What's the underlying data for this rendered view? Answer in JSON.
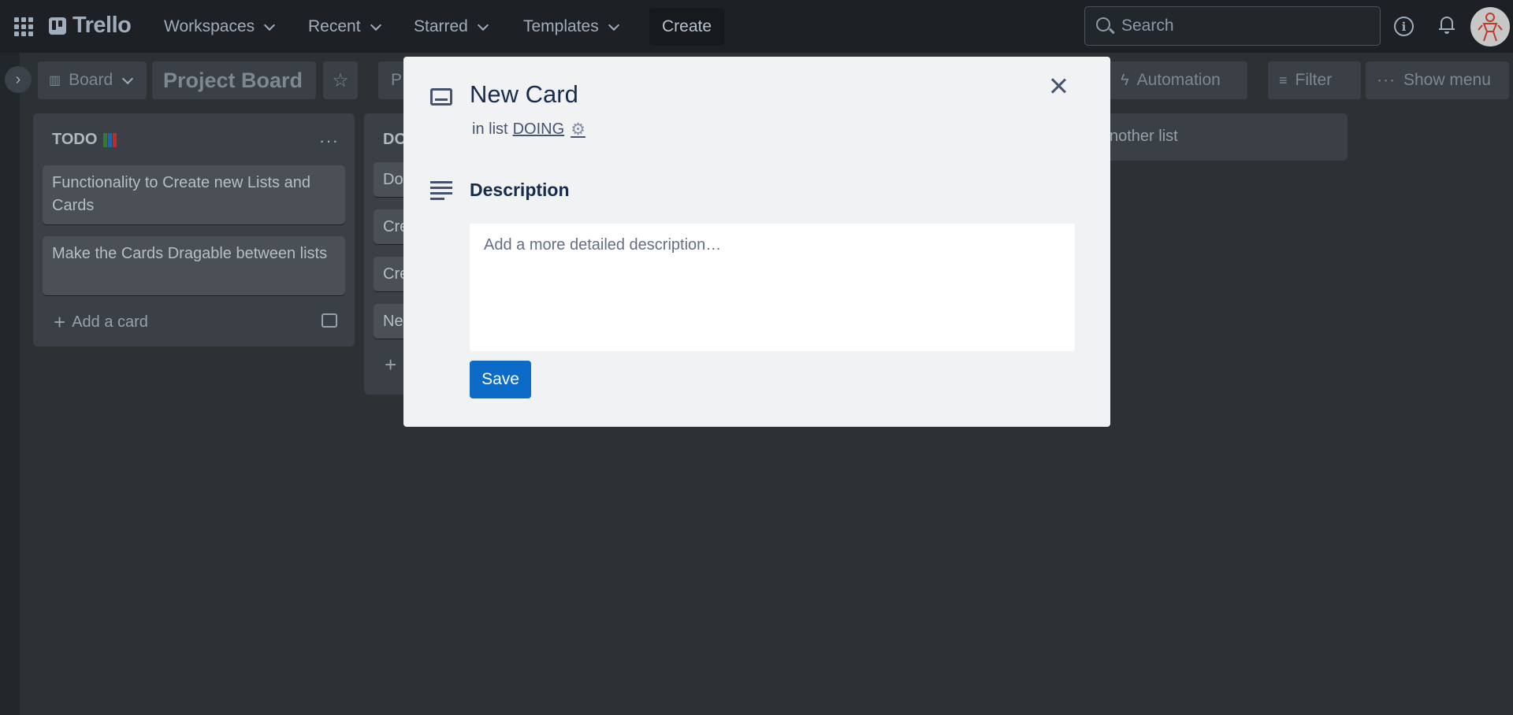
{
  "topbar": {
    "logo_text": "Trello",
    "nav": [
      {
        "label": "Workspaces"
      },
      {
        "label": "Recent"
      },
      {
        "label": "Starred"
      },
      {
        "label": "Templates"
      }
    ],
    "create_label": "Create",
    "search_placeholder": "Search"
  },
  "board_header": {
    "view_label": "Board",
    "title": "Project Board",
    "partial_label": "P",
    "automation_label": "Automation",
    "filter_label": "Filter",
    "show_menu_label": "Show menu"
  },
  "lists": [
    {
      "title": "TODO",
      "cards": [
        "Functionality to Create new Lists and Cards",
        "Make the Cards Dragable between lists"
      ],
      "add_card_label": "Add a card"
    },
    {
      "title": "DO",
      "cards": [
        "Do",
        "Cre",
        "Cre",
        "Ne"
      ]
    }
  ],
  "add_list_partial": "nother list",
  "modal": {
    "title": "New Card",
    "in_list_prefix": "in list",
    "list_name": "DOING",
    "description_heading": "Description",
    "description_placeholder": "Add a more detailed description…",
    "save_label": "Save"
  },
  "colors": {
    "save_button": "#0c6bc7",
    "modal_bg": "#f1f2f4",
    "overlay_bg": "#2c3134"
  }
}
